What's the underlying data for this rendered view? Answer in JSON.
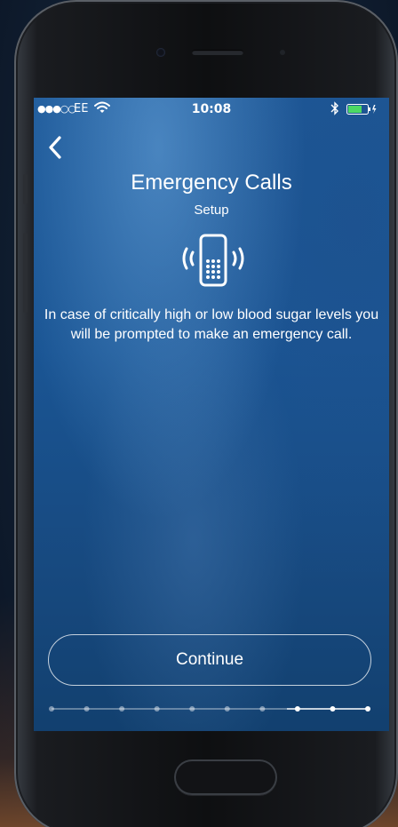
{
  "status_bar": {
    "signal": "●●●○○",
    "carrier": "EE",
    "time": "10:08"
  },
  "header": {
    "title": "Emergency Calls",
    "subtitle": "Setup"
  },
  "body": {
    "description": "In case of critically high or low blood sugar levels you will be prompted to make an emergency call."
  },
  "actions": {
    "continue_label": "Continue"
  },
  "progress": {
    "total_steps": 10,
    "current_step": 7
  },
  "icons": {
    "back": "chevron-left-icon",
    "phone": "ringing-phone-icon",
    "wifi": "wifi-icon",
    "bluetooth": "bluetooth-icon",
    "battery": "battery-charging-icon"
  },
  "colors": {
    "battery_level": "#4cd964",
    "progress_done": "rgba(255,255,255,0.45)",
    "progress_current": "#ffffff"
  }
}
